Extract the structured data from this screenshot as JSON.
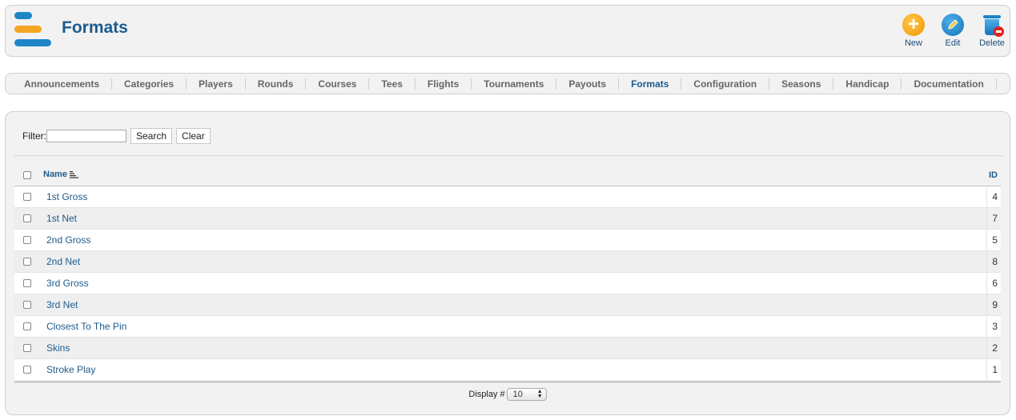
{
  "header": {
    "title": "Formats",
    "buttons": {
      "new": "New",
      "edit": "Edit",
      "delete": "Delete"
    }
  },
  "nav": {
    "items": [
      "Announcements",
      "Categories",
      "Players",
      "Rounds",
      "Courses",
      "Tees",
      "Flights",
      "Tournaments",
      "Payouts",
      "Formats",
      "Configuration",
      "Seasons",
      "Handicap",
      "Documentation"
    ],
    "active": "Formats"
  },
  "filter": {
    "label": "Filter:",
    "value": "",
    "search_label": "Search",
    "clear_label": "Clear"
  },
  "table": {
    "columns": {
      "name": "Name",
      "id": "ID"
    },
    "rows": [
      {
        "name": "1st Gross",
        "id": "4"
      },
      {
        "name": "1st Net",
        "id": "7"
      },
      {
        "name": "2nd Gross",
        "id": "5"
      },
      {
        "name": "2nd Net",
        "id": "8"
      },
      {
        "name": "3rd Gross",
        "id": "6"
      },
      {
        "name": "3rd Net",
        "id": "9"
      },
      {
        "name": "Closest To The Pin",
        "id": "3"
      },
      {
        "name": "Skins",
        "id": "2"
      },
      {
        "name": "Stroke Play",
        "id": "1"
      }
    ]
  },
  "footer": {
    "display_label": "Display #",
    "display_value": "10"
  },
  "colors": {
    "brand_blue": "#1d5b8c",
    "accent_orange": "#f5a623"
  }
}
